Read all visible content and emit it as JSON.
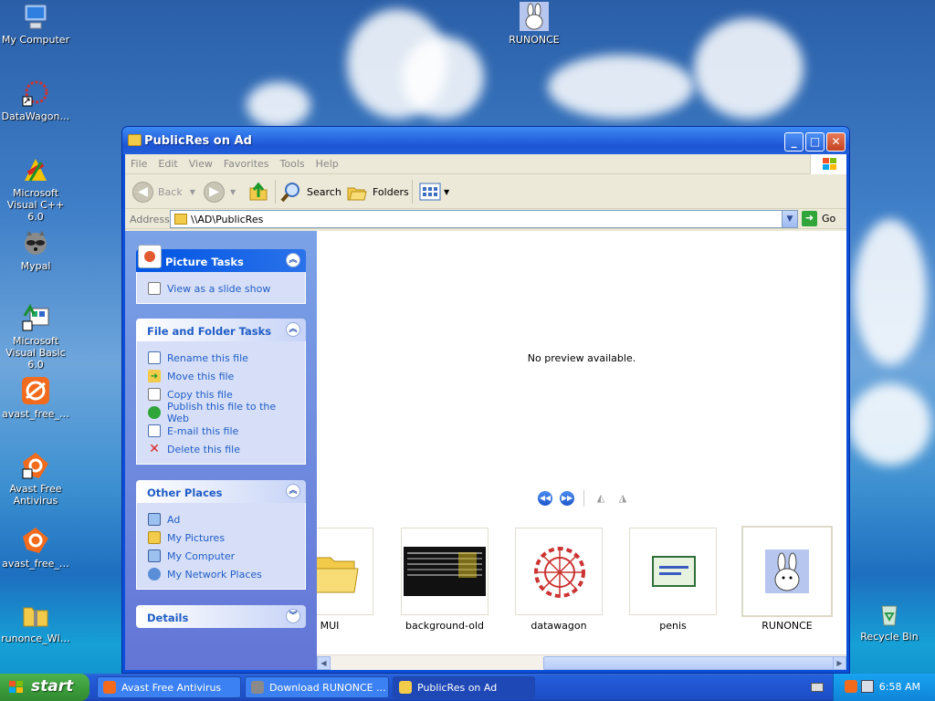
{
  "desktop": {
    "icons": [
      {
        "label": "My Computer"
      },
      {
        "label": "DataWagon…"
      },
      {
        "label": "Microsoft Visual C++ 6.0"
      },
      {
        "label": "Mypal"
      },
      {
        "label": "Microsoft Visual Basic 6.0"
      },
      {
        "label": "avast_free_…"
      },
      {
        "label": "Avast Free Antivirus"
      },
      {
        "label": "avast_free_…"
      },
      {
        "label": "runonce_WI…"
      },
      {
        "label": "RUNONCE"
      },
      {
        "label": "Recycle Bin"
      }
    ]
  },
  "window": {
    "title": "PublicRes on Ad",
    "menu": [
      "File",
      "Edit",
      "View",
      "Favorites",
      "Tools",
      "Help"
    ],
    "toolbar": {
      "back": "Back",
      "search": "Search",
      "folders": "Folders"
    },
    "address": {
      "label": "Address",
      "value": "\\\\AD\\PublicRes",
      "go": "Go"
    },
    "tasks": {
      "picture": {
        "title": "Picture Tasks",
        "items": [
          "View as a slide show"
        ]
      },
      "file": {
        "title": "File and Folder Tasks",
        "items": [
          "Rename this file",
          "Move this file",
          "Copy this file",
          "Publish this file to the Web",
          "E-mail this file",
          "Delete this file"
        ]
      },
      "other": {
        "title": "Other Places",
        "items": [
          "Ad",
          "My Pictures",
          "My Computer",
          "My Network Places"
        ]
      },
      "details": {
        "title": "Details"
      }
    },
    "preview": {
      "message": "No preview available."
    },
    "thumbnails": [
      {
        "label": "MUI"
      },
      {
        "label": "background-old"
      },
      {
        "label": "datawagon"
      },
      {
        "label": "penis"
      },
      {
        "label": "RUNONCE"
      }
    ]
  },
  "taskbar": {
    "start": "start",
    "tasks": [
      {
        "label": "Avast Free Antivirus"
      },
      {
        "label": "Download RUNONCE ..."
      },
      {
        "label": "PublicRes on Ad"
      }
    ],
    "clock": "6:58 AM"
  }
}
